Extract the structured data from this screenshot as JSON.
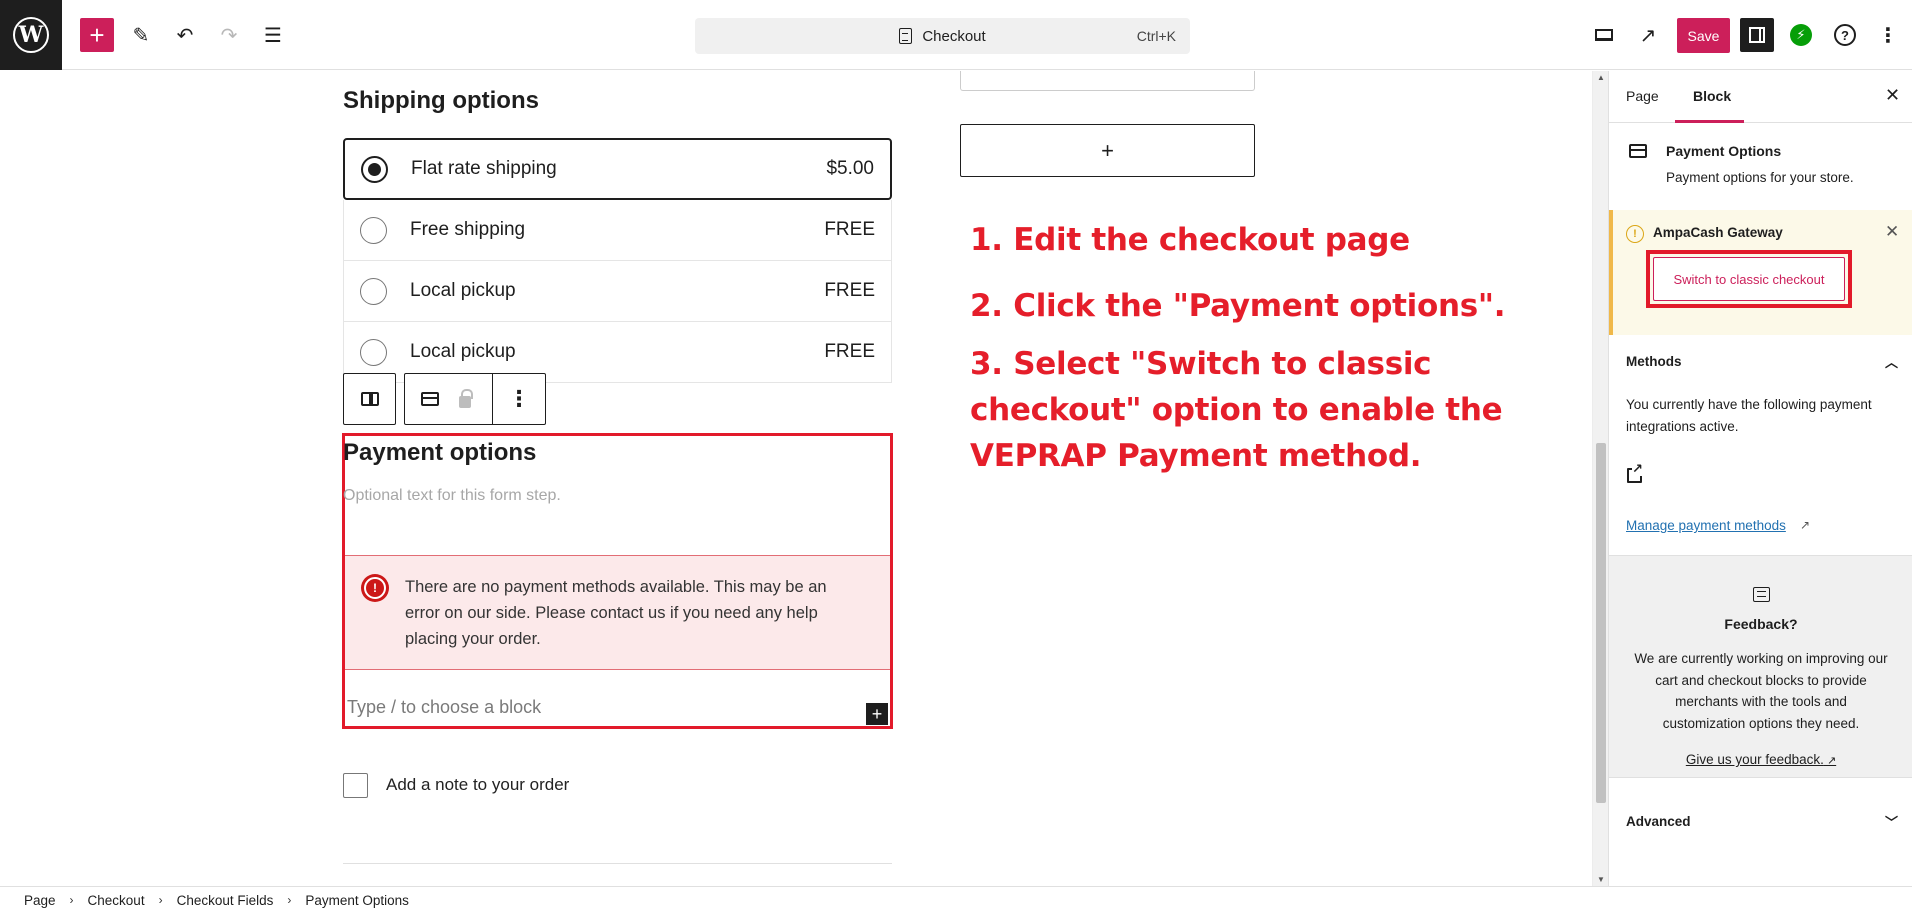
{
  "toolbar": {
    "doc_title": "Checkout",
    "shortcut": "Ctrl+K",
    "save_label": "Save",
    "icons": [
      "wordpress-logo",
      "plus-icon",
      "pen-icon",
      "undo-icon",
      "redo-icon",
      "list-view-icon",
      "document-icon",
      "desktop-preview-icon",
      "external-view-icon",
      "settings-panel-icon",
      "jetpack-icon",
      "help-icon",
      "kebab-icon"
    ]
  },
  "editor": {
    "shipping": {
      "title": "Shipping options",
      "options": [
        {
          "label": "Flat rate shipping",
          "price": "$5.00",
          "selected": true
        },
        {
          "label": "Free shipping",
          "price": "FREE",
          "selected": false
        },
        {
          "label": "Local pickup",
          "price": "FREE",
          "selected": false
        },
        {
          "label": "Local pickup",
          "price": "FREE",
          "selected": false
        }
      ]
    },
    "payment": {
      "title": "Payment options",
      "placeholder": "Optional text for this form step.",
      "notice": "There are no payment methods available. This may be an error on our side. Please contact us if you need any help placing your order.",
      "type_hint": "Type / to choose a block"
    },
    "note_label": "Add a note to your order",
    "add_block_symbol": "+"
  },
  "instructions": [
    "1. Edit the checkout page",
    "2. Click the \"Payment options\".",
    "3. Select \"Switch to classic checkout\" option to enable the VEPRAP Payment method."
  ],
  "sidebar": {
    "tabs": [
      "Page",
      "Block"
    ],
    "active_tab": "Block",
    "block_name": "Payment Options",
    "block_desc": "Payment options for your store.",
    "gateway_title": "AmpaCash Gateway",
    "gateway_button": "Switch to classic checkout",
    "methods_heading": "Methods",
    "methods_text": "You currently have the following payment integrations active.",
    "manage_link": "Manage payment methods",
    "manage_arrow": "↗",
    "feedback_title": "Feedback?",
    "feedback_text": "We are currently working on improving our cart and checkout blocks to provide merchants with the tools and customization options they need.",
    "feedback_link": "Give us your feedback.",
    "advanced_heading": "Advanced"
  },
  "breadcrumbs": [
    "Page",
    "Checkout",
    "Checkout Fields",
    "Payment Options"
  ],
  "colors": {
    "accent": "#cc1f5a",
    "annotation_red": "#e21a2a",
    "error_bg": "#fce9ea",
    "warning_border": "#f0b849"
  }
}
